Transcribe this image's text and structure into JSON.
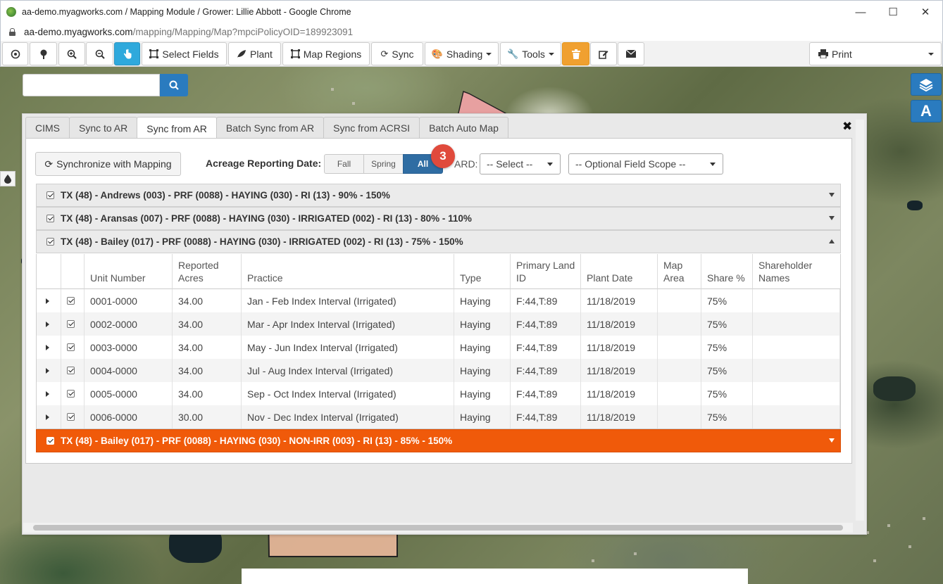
{
  "window": {
    "title": "aa-demo.myagworks.com / Mapping Module / Grower: Lillie Abbott - Google Chrome",
    "url_host": "aa-demo.myagworks.com",
    "url_path": "/mapping/Mapping/Map?mpciPolicyOID=189923091",
    "minimize": "—",
    "maximize": "☐",
    "close": "✕"
  },
  "toolbar": {
    "select_fields": "Select Fields",
    "plant": "Plant",
    "map_regions": "Map Regions",
    "sync": "Sync",
    "shading": "Shading",
    "tools": "Tools",
    "print": "Print"
  },
  "colors": {
    "accent_blue": "#2a7bbf",
    "active_tool": "#2fa9dc",
    "delete_orange": "#f0a030",
    "highlight_row": "#f05a0a",
    "badge_red": "#e04a3c"
  },
  "map_controls": {
    "layers_icon": "layers-icon",
    "label_button": "A"
  },
  "panel": {
    "tabs": [
      "CIMS",
      "Sync to AR",
      "Sync from AR",
      "Batch Sync from AR",
      "Sync from ACRSI",
      "Batch Auto Map"
    ],
    "active_tab": "Sync from AR",
    "close": "✖",
    "sync_button": "Synchronize with Mapping",
    "ard_label": "Acreage Reporting Date:",
    "segments": [
      "Fall",
      "Spring",
      "All"
    ],
    "selected_segment": "All",
    "badge": "3",
    "ard_short": "ARD:",
    "ard_select": "-- Select --",
    "field_scope": "-- Optional Field Scope --"
  },
  "policies": [
    {
      "label": "TX (48) - Andrews (003) - PRF (0088) - HAYING (030) - RI (13) - 90% - 150%",
      "expanded": false
    },
    {
      "label": "TX (48) - Aransas (007) - PRF (0088) - HAYING (030) - IRRIGATED (002) - RI (13) - 80% - 110%",
      "expanded": false
    },
    {
      "label": "TX (48) - Bailey (017) - PRF (0088) - HAYING (030) - IRRIGATED (002) - RI (13) - 75% - 150%",
      "expanded": true
    },
    {
      "label": "TX (48) - Bailey (017) - PRF (0088) - HAYING (030) - NON-IRR (003) - RI (13) - 85% - 150%",
      "expanded": false,
      "highlighted": true
    }
  ],
  "grid": {
    "columns": [
      "Unit Number",
      "Reported Acres",
      "Practice",
      "Type",
      "Primary Land ID",
      "Plant Date",
      "Map Area",
      "Share %",
      "Shareholder Names"
    ],
    "rows": [
      {
        "unit": "0001-0000",
        "acres": "34.00",
        "practice": "Jan - Feb Index Interval (Irrigated)",
        "type": "Haying",
        "land_id": "F:44,T:89",
        "plant_date": "11/18/2019",
        "map_area": "",
        "share": "75%",
        "shareholders": ""
      },
      {
        "unit": "0002-0000",
        "acres": "34.00",
        "practice": "Mar - Apr Index Interval (Irrigated)",
        "type": "Haying",
        "land_id": "F:44,T:89",
        "plant_date": "11/18/2019",
        "map_area": "",
        "share": "75%",
        "shareholders": ""
      },
      {
        "unit": "0003-0000",
        "acres": "34.00",
        "practice": "May - Jun Index Interval (Irrigated)",
        "type": "Haying",
        "land_id": "F:44,T:89",
        "plant_date": "11/18/2019",
        "map_area": "",
        "share": "75%",
        "shareholders": ""
      },
      {
        "unit": "0004-0000",
        "acres": "34.00",
        "practice": "Jul - Aug Index Interval (Irrigated)",
        "type": "Haying",
        "land_id": "F:44,T:89",
        "plant_date": "11/18/2019",
        "map_area": "",
        "share": "75%",
        "shareholders": ""
      },
      {
        "unit": "0005-0000",
        "acres": "34.00",
        "practice": "Sep - Oct Index Interval (Irrigated)",
        "type": "Haying",
        "land_id": "F:44,T:89",
        "plant_date": "11/18/2019",
        "map_area": "",
        "share": "75%",
        "shareholders": ""
      },
      {
        "unit": "0006-0000",
        "acres": "30.00",
        "practice": "Nov - Dec Index Interval (Irrigated)",
        "type": "Haying",
        "land_id": "F:44,T:89",
        "plant_date": "11/18/2019",
        "map_area": "",
        "share": "75%",
        "shareholders": ""
      }
    ]
  }
}
